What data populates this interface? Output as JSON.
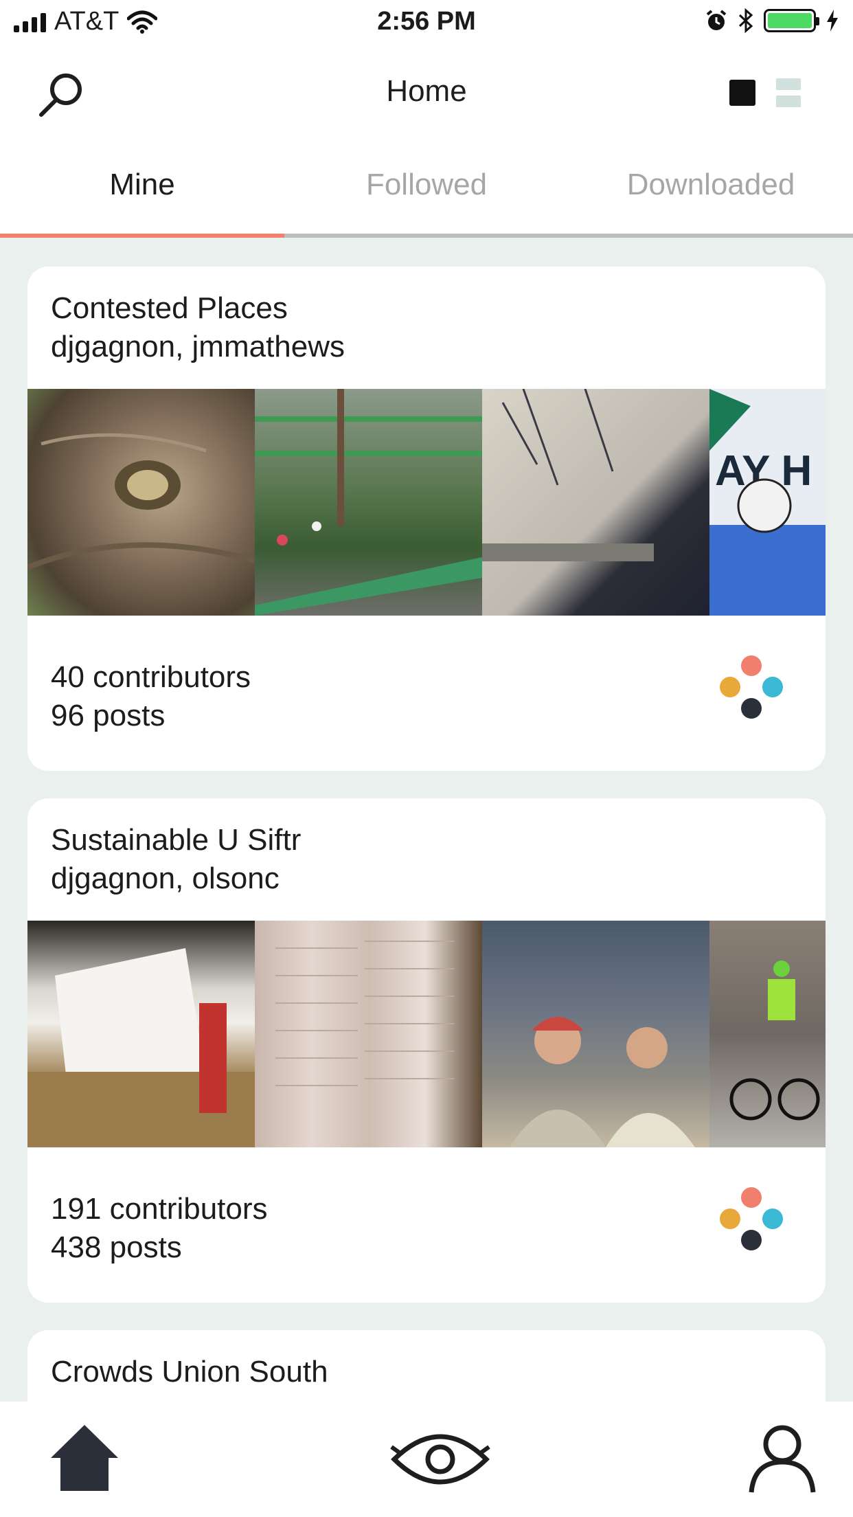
{
  "status_bar": {
    "carrier": "AT&T",
    "time": "2:56 PM",
    "battery_color": "#4cd964"
  },
  "nav": {
    "title": "Home",
    "search_icon": "search-icon",
    "grid_icon": "grid-view-icon",
    "list_icon": "list-view-icon"
  },
  "tabs": [
    {
      "label": "Mine",
      "active": true
    },
    {
      "label": "Followed",
      "active": false
    },
    {
      "label": "Downloaded",
      "active": false
    }
  ],
  "accent_color": "#f07f6e",
  "cards": [
    {
      "title": "Contested Places",
      "authors": "djgagnon, jmmathews",
      "contributors": "40 contributors",
      "posts": "96 posts",
      "thumb_colors": [
        "#8a7560",
        "#3f7a3e",
        "#b9b6ae",
        "#3a6fd0"
      ]
    },
    {
      "title": "Sustainable U Siftr",
      "authors": "djgagnon, olsonc",
      "contributors": "191 contributors",
      "posts": "438 posts",
      "thumb_colors": [
        "#8d6e45",
        "#d8c9c1",
        "#6d6156",
        "#6e6a68"
      ]
    },
    {
      "title": "Crowds Union South",
      "authors": ""
    }
  ],
  "siftr_logo_colors": [
    "#f07f6e",
    "#e8a93a",
    "#3bb8d3",
    "#2b2f3a"
  ],
  "tab_bar": {
    "items": [
      "home-icon",
      "eye-icon",
      "profile-icon"
    ]
  }
}
